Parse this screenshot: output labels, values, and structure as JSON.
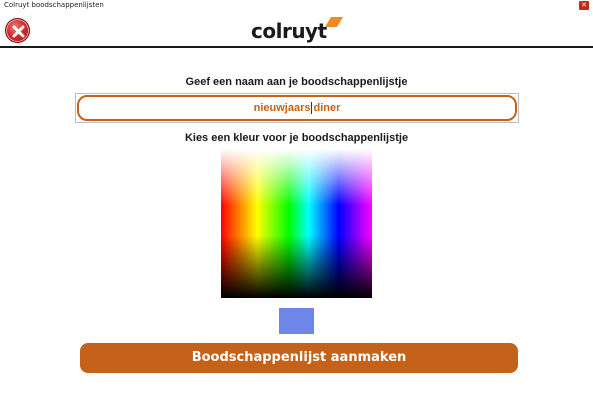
{
  "window": {
    "title": "Colruyt boodschappenlijsten",
    "close_glyph": "✕"
  },
  "header": {
    "back_icon": "close-circle-icon",
    "logo_text": "colruyt",
    "logo_mark_color": "#f08a24"
  },
  "name_section": {
    "label": "Geef een naam aan je boodschappenlijstje",
    "value_before_caret": "nieuwjaars",
    "value_after_caret": "diner"
  },
  "color_section": {
    "label": "Kies een kleur voor je boodschappenlijstje",
    "selected_color": "#6f86e9"
  },
  "actions": {
    "create_label": "Boodschappenlijst aanmaken"
  },
  "colors": {
    "accent": "#c4621a",
    "back_button": "#d42a2a"
  }
}
